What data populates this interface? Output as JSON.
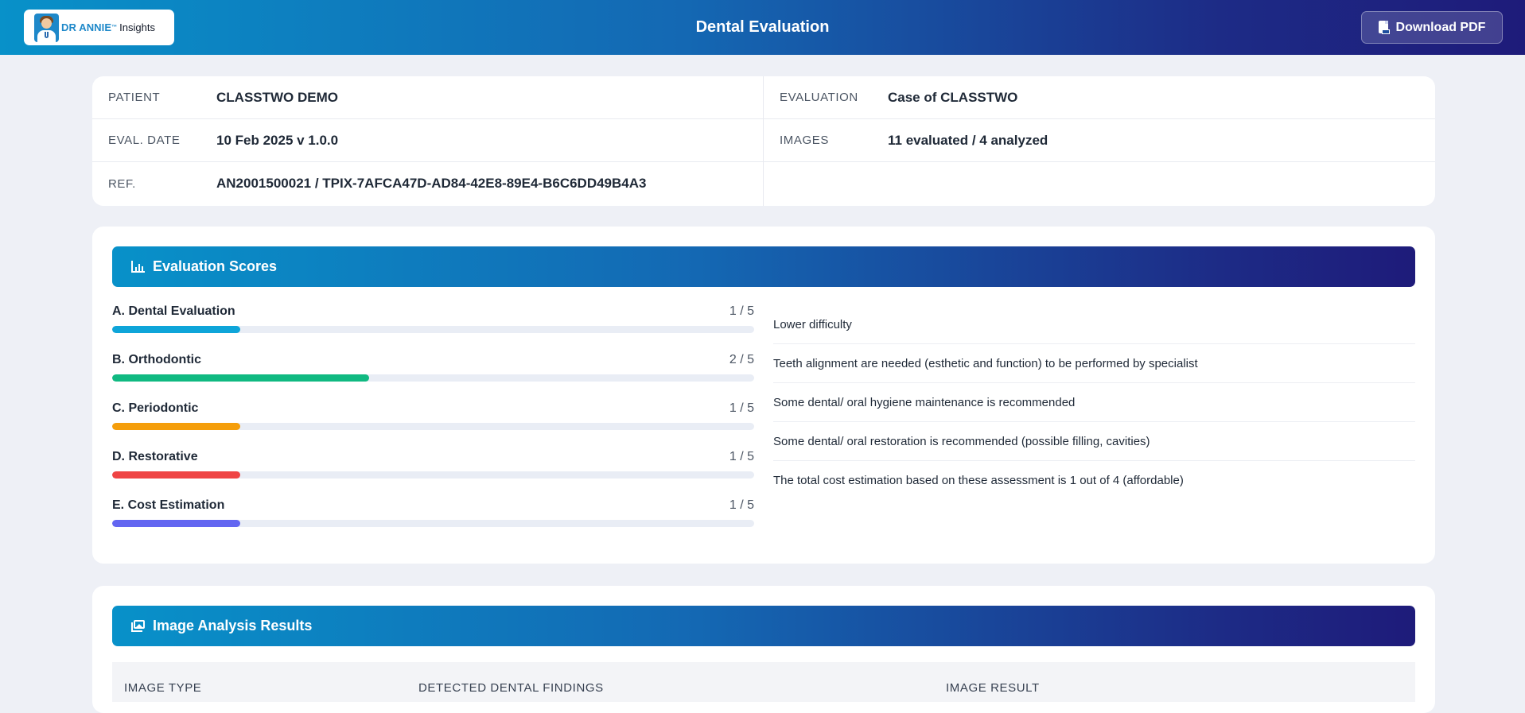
{
  "header": {
    "brand": "DR ANNIE",
    "brand_tm": "™",
    "brand_suffix": "Insights",
    "title": "Dental Evaluation",
    "download_label": "Download PDF"
  },
  "info": {
    "left": [
      {
        "label": "PATIENT",
        "value": "CLASSTWO DEMO"
      },
      {
        "label": "EVAL. DATE",
        "value": "10 Feb 2025 v 1.0.0"
      },
      {
        "label": "REF.",
        "value": "AN2001500021 / TPIX-7AFCA47D-AD84-42E8-89E4-B6C6DD49B4A3"
      }
    ],
    "right": [
      {
        "label": "EVALUATION",
        "value": "Case of CLASSTWO"
      },
      {
        "label": "IMAGES",
        "value": "11 evaluated / 4 analyzed"
      }
    ]
  },
  "scores": {
    "title": "Evaluation Scores",
    "items": [
      {
        "name": "A. Dental Evaluation",
        "value_text": "1 / 5",
        "score": 1,
        "max": 5,
        "color": "#0ea5d9"
      },
      {
        "name": "B. Orthodontic",
        "value_text": "2 / 5",
        "score": 2,
        "max": 5,
        "color": "#10b981"
      },
      {
        "name": "C. Periodontic",
        "value_text": "1 / 5",
        "score": 1,
        "max": 5,
        "color": "#f59e0b"
      },
      {
        "name": "D. Restorative",
        "value_text": "1 / 5",
        "score": 1,
        "max": 5,
        "color": "#ef4444"
      },
      {
        "name": "E. Cost Estimation",
        "value_text": "1 / 5",
        "score": 1,
        "max": 5,
        "color": "#6366f1"
      }
    ],
    "notes": [
      "Lower difficulty",
      "Teeth alignment are needed (esthetic and function) to be performed by specialist",
      "Some dental/ oral hygiene maintenance is recommended",
      "Some dental/ oral restoration is recommended (possible filling, cavities)",
      "The total cost estimation based on these assessment is 1 out of 4 (affordable)"
    ]
  },
  "analysis": {
    "title": "Image Analysis Results",
    "columns": [
      "IMAGE TYPE",
      "DETECTED DENTAL FINDINGS",
      "IMAGE RESULT"
    ]
  }
}
